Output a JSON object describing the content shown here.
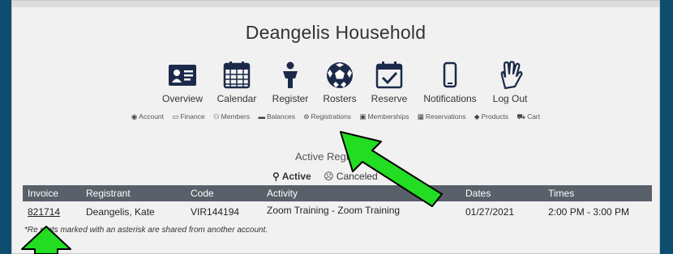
{
  "household": {
    "title": "Deangelis Household"
  },
  "nav": {
    "items": [
      {
        "label": "Overview",
        "icon": "id-card-icon"
      },
      {
        "label": "Calendar",
        "icon": "calendar-grid-icon"
      },
      {
        "label": "Register",
        "icon": "person-icon"
      },
      {
        "label": "Rosters",
        "icon": "soccer-ball-icon"
      },
      {
        "label": "Reserve",
        "icon": "calendar-check-icon"
      },
      {
        "label": "Notifications",
        "icon": "phone-icon"
      },
      {
        "label": "Log Out",
        "icon": "hand-icon"
      }
    ]
  },
  "subnav": {
    "items": [
      {
        "label": "Account",
        "glyph": "◉"
      },
      {
        "label": "Finance",
        "glyph": "▭"
      },
      {
        "label": "Members",
        "glyph": "⚇"
      },
      {
        "label": "Balances",
        "glyph": "▬"
      },
      {
        "label": "Registrations",
        "glyph": "⊛"
      },
      {
        "label": "Memberships",
        "glyph": "▣"
      },
      {
        "label": "Reservations",
        "glyph": "▦"
      },
      {
        "label": "Products",
        "glyph": "◆"
      },
      {
        "label": "Cart",
        "glyph": "⛟"
      }
    ]
  },
  "registrations": {
    "title": "Active Regi",
    "tabs": [
      {
        "label": "Active",
        "glyph": "⚲"
      },
      {
        "label": "Canceled",
        "glyph": "☹"
      }
    ],
    "columns": [
      "Invoice",
      "Registrant",
      "Code",
      "Activity",
      "Dates",
      "Times"
    ],
    "rows": [
      {
        "invoice": "821714",
        "registrant": "Deangelis, Kate",
        "code": "VIR144194",
        "activity": "Zoom Training - Zoom Training",
        "dates": "01/27/2021",
        "times": "2:00 PM - 3:00 PM"
      }
    ],
    "footnote": "*Re        rants marked with an asterisk are shared from another account."
  },
  "colors": {
    "background": "#0d4d6e",
    "panel": "#f1f1f1",
    "table_header": "#59606a",
    "icon_navy": "#1b2a4a",
    "arrow": "#22dd22"
  }
}
